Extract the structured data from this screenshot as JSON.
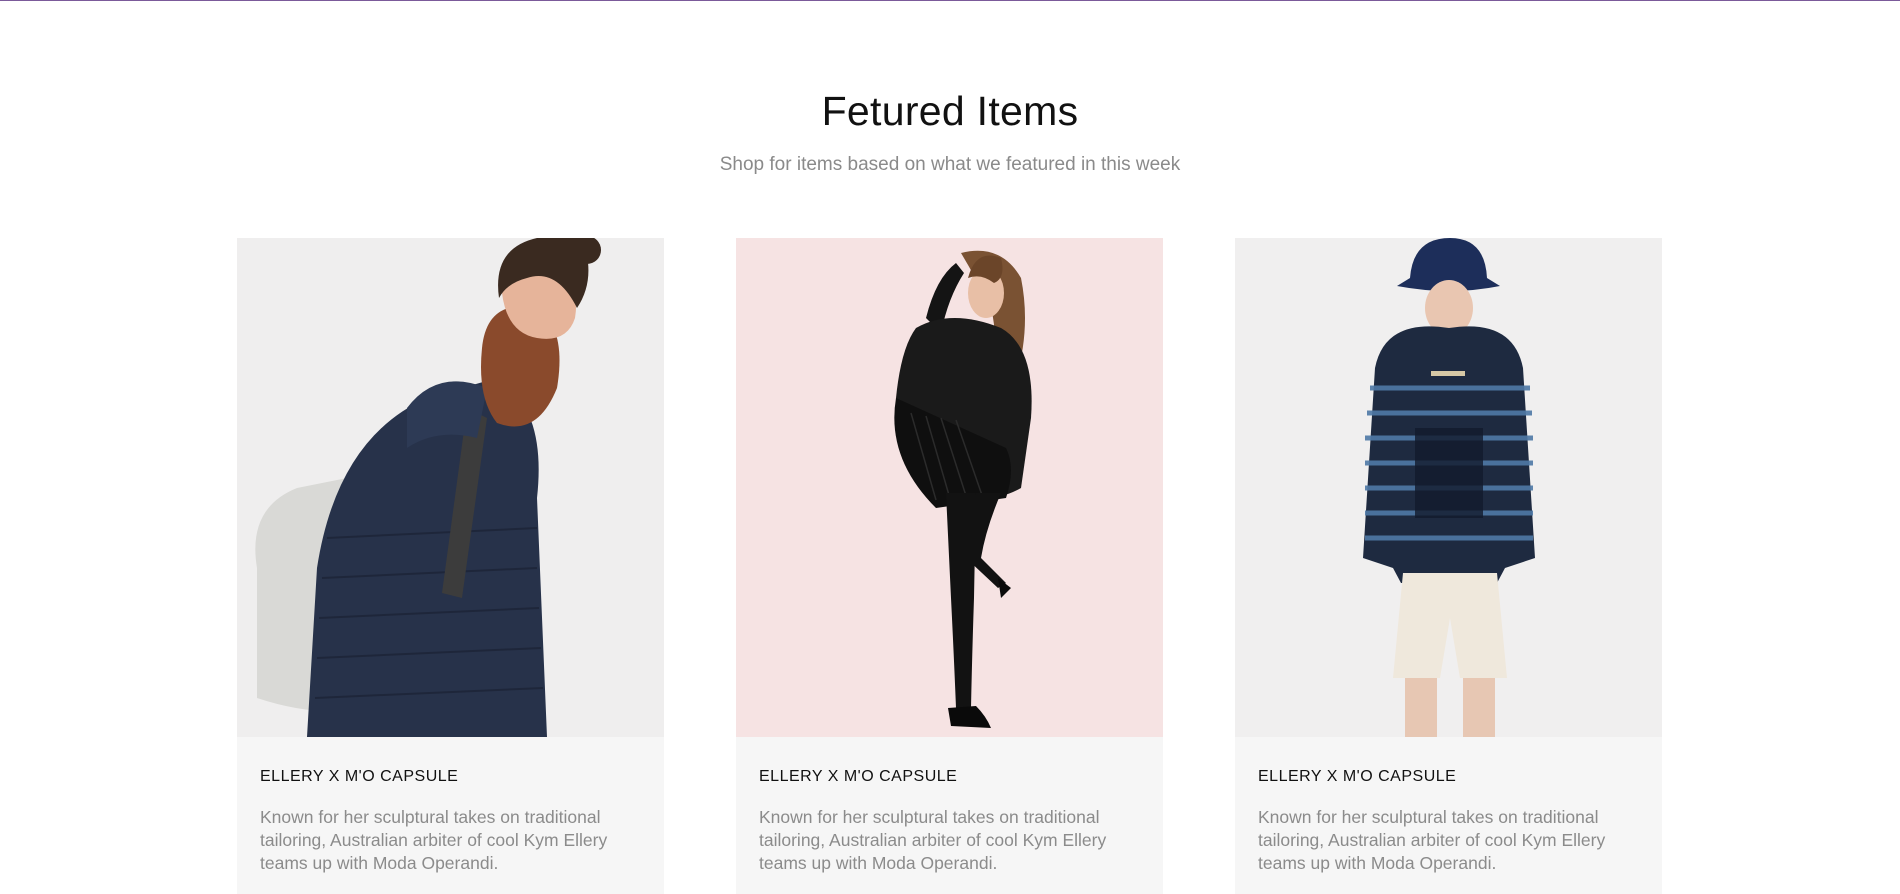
{
  "section": {
    "title": "Fetured Items",
    "subtitle": "Shop for items based on what we featured in this week"
  },
  "cards": [
    {
      "title": "ELLERY X M'O CAPSULE",
      "description": "Known for her sculptural takes on traditional tailoring, Australian arbiter of cool Kym Ellery teams up with Moda Operandi.",
      "image_bg": "#efeeee"
    },
    {
      "title": "ELLERY X M'O CAPSULE",
      "description": "Known for her sculptural takes on traditional tailoring, Australian arbiter of cool Kym Ellery teams up with Moda Operandi.",
      "image_bg": "#f6e3e3"
    },
    {
      "title": "ELLERY X M'O CAPSULE",
      "description": "Known for her sculptural takes on traditional tailoring, Australian arbiter of cool Kym Ellery teams up with Moda Operandi.",
      "image_bg": "#f0efef"
    }
  ]
}
